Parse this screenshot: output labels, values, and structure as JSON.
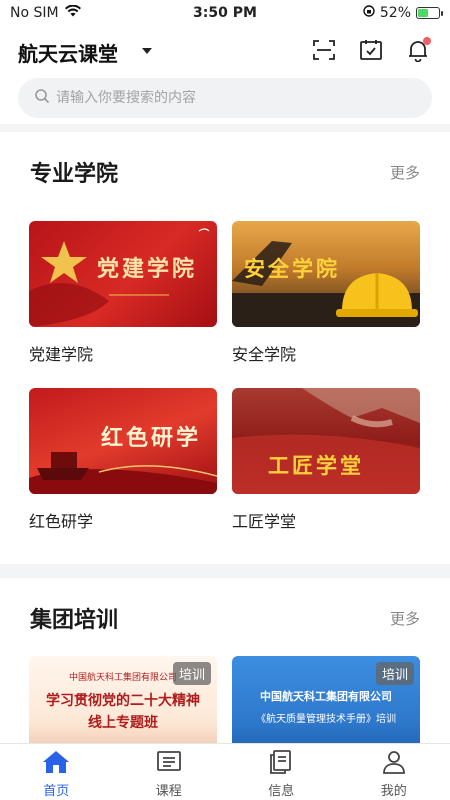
{
  "status_bar": {
    "carrier": "No SIM",
    "time": "3:50 PM",
    "battery": "52%",
    "battery_level": 0.52
  },
  "header": {
    "title": "航天云课堂"
  },
  "search": {
    "placeholder": "请输入你要搜索的内容"
  },
  "section_academies": {
    "title": "专业学院",
    "more": "更多",
    "cards": [
      {
        "label": "党建学院",
        "banner": "党建学院"
      },
      {
        "label": "安全学院",
        "banner": "安全学院"
      },
      {
        "label": "红色研学",
        "banner": "红色研学"
      },
      {
        "label": "工匠学堂",
        "banner": "工匠学堂"
      }
    ]
  },
  "section_training": {
    "title": "集团培训",
    "more": "更多",
    "cards": [
      {
        "tag": "培训",
        "line1": "中国航天科工集团有限公司",
        "line2": "学习贯彻党的二十大精神",
        "line3": "线上专题班"
      },
      {
        "tag": "培训",
        "line1": "中国航天科工集团有限公司",
        "line2": "《航天质量管理技术手册》培训"
      }
    ]
  },
  "tabbar": {
    "tabs": [
      {
        "label": "首页"
      },
      {
        "label": "课程"
      },
      {
        "label": "信息"
      },
      {
        "label": "我的"
      }
    ]
  },
  "colors": {
    "accent": "#2962e8",
    "notification": "#f06060"
  }
}
